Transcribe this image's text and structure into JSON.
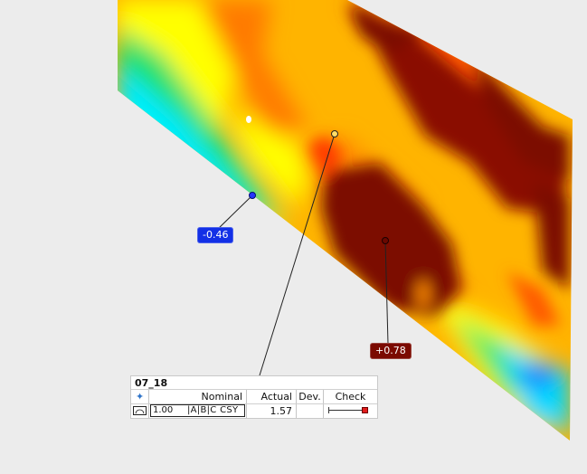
{
  "colors": {
    "deviation_negative_badge": "#1330e6",
    "deviation_positive_badge": "#7b0a00",
    "color_map": [
      "#00e6ff",
      "#1fe070",
      "#ffff00",
      "#ff9a00",
      "#ff2a00",
      "#7b0a00"
    ]
  },
  "callouts": [
    {
      "label": "-0.46"
    },
    {
      "label": "+0.78"
    }
  ],
  "fcf": {
    "title": "07_18",
    "headers": {
      "symbol_icon": "crosshair-icon",
      "nominal": "Nominal",
      "actual": "Actual",
      "dev": "Dev.",
      "check": "Check"
    },
    "row": {
      "symbol_icon": "profile-icon",
      "tolerance": "1.00",
      "datums": "|A|B|C CSY",
      "actual": "1.57",
      "dev": ""
    }
  }
}
